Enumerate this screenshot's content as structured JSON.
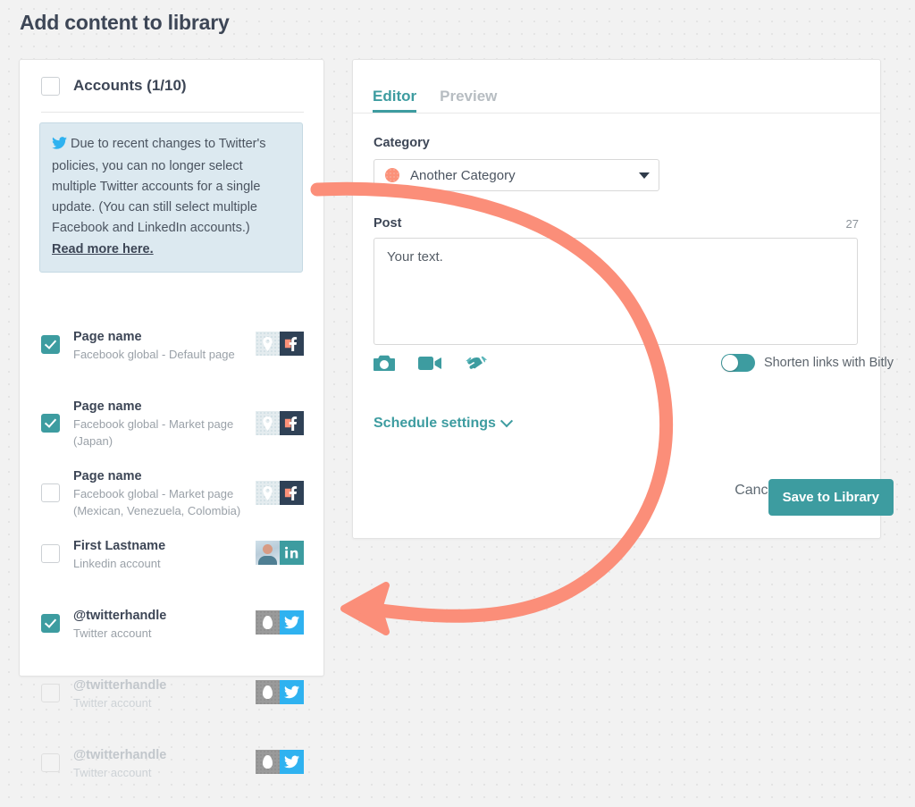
{
  "page": {
    "title": "Add content to library"
  },
  "accounts_panel": {
    "header_label": "Accounts (1/10)",
    "header_checked": false,
    "notice": {
      "icon": "twitter-bird-icon",
      "text": "Due to recent changes to Twitter's policies, you can no longer select multiple Twitter accounts for a single update. (You can still select multiple Facebook and LinkedIn accounts.)",
      "link_label": "Read more here."
    },
    "rows": [
      {
        "name": "Page name",
        "subtitle": "Facebook global - Default page",
        "checked": true,
        "disabled": false,
        "network": "facebook",
        "avatar": "placeholder-pin-avatar"
      },
      {
        "name": "Page name",
        "subtitle": "Facebook global - Market page (Japan)",
        "checked": true,
        "disabled": false,
        "network": "facebook",
        "avatar": "placeholder-pin-avatar"
      },
      {
        "name": "Page name",
        "subtitle": "Facebook global - Market page (Mexican, Venezuela, Colombia)",
        "checked": false,
        "disabled": false,
        "network": "facebook",
        "avatar": "placeholder-pin-avatar"
      },
      {
        "name": "First Lastname",
        "subtitle": "Linkedin account",
        "checked": false,
        "disabled": false,
        "network": "linkedin",
        "avatar": "photo-avatar"
      },
      {
        "name": "@twitterhandle",
        "subtitle": "Twitter account",
        "checked": true,
        "disabled": false,
        "network": "twitter",
        "avatar": "egg-avatar"
      },
      {
        "name": "@twitterhandle",
        "subtitle": "Twitter account",
        "checked": false,
        "disabled": true,
        "network": "twitter",
        "avatar": "egg-avatar"
      },
      {
        "name": "@twitterhandle",
        "subtitle": "Twitter account",
        "checked": false,
        "disabled": true,
        "network": "twitter",
        "avatar": "egg-avatar"
      }
    ]
  },
  "editor_panel": {
    "tabs": [
      {
        "label": "Editor",
        "active": true
      },
      {
        "label": "Preview",
        "active": false
      }
    ],
    "category": {
      "label": "Category",
      "selected": "Another Category",
      "dot_color": "#fc9179"
    },
    "post": {
      "label": "Post",
      "char_count": "27",
      "value": "Your text."
    },
    "toolbar": [
      {
        "icon": "camera-icon"
      },
      {
        "icon": "video-camera-icon"
      },
      {
        "icon": "handshake-icon"
      }
    ],
    "bitly": {
      "label": "Shorten links with Bitly",
      "enabled": false
    },
    "schedule_label": "Schedule settings",
    "cancel_label": "Cancel",
    "save_label": "Save to Library"
  },
  "annotation": {
    "type": "curved-arrow",
    "color": "#fb8e79"
  },
  "colors": {
    "accent_teal": "#3d9ca0",
    "salmon": "#fc9179",
    "text_dark": "#3d4656",
    "facebook": "#2f4156",
    "twitter": "#2fb2f0",
    "linkedin": "#3d9ca0"
  }
}
